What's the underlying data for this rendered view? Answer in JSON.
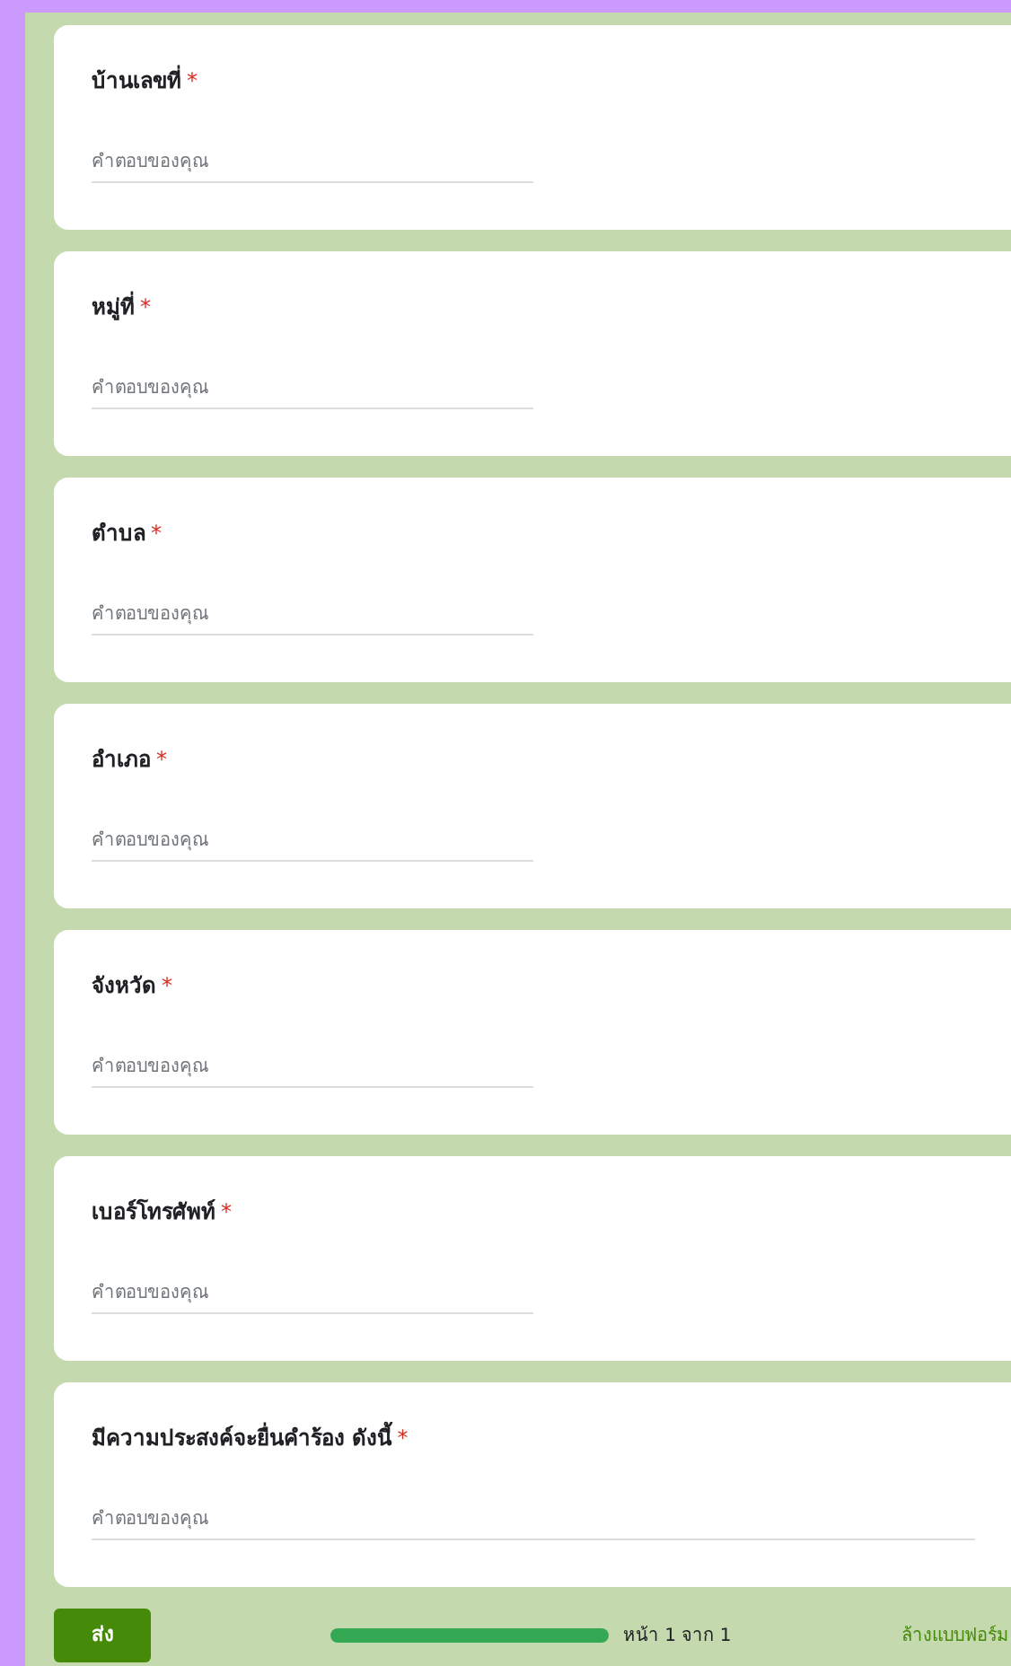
{
  "questions": [
    {
      "title": "บ้านเลขที่",
      "required": true,
      "placeholder": "คำตอบของคุณ",
      "kind": "short"
    },
    {
      "title": "หมู่ที่",
      "required": true,
      "placeholder": "คำตอบของคุณ",
      "kind": "short"
    },
    {
      "title": "ตำบล",
      "required": true,
      "placeholder": "คำตอบของคุณ",
      "kind": "short"
    },
    {
      "title": "อำเภอ",
      "required": true,
      "placeholder": "คำตอบของคุณ",
      "kind": "short"
    },
    {
      "title": "จังหวัด",
      "required": true,
      "placeholder": "คำตอบของคุณ",
      "kind": "short"
    },
    {
      "title": "เบอร์โทรศัพท์",
      "required": true,
      "placeholder": "คำตอบของคุณ",
      "kind": "short"
    },
    {
      "title": "มีความประสงค์จะยื่นคำร้อง ดังนี้",
      "required": true,
      "placeholder": "คำตอบของคุณ",
      "kind": "long"
    }
  ],
  "required_mark": "*",
  "footer": {
    "submit": "ส่ง",
    "progress": {
      "level": 1,
      "label": "หน้า 1 จาก 1"
    },
    "clear": "ล้างแบบฟอร์ม"
  }
}
